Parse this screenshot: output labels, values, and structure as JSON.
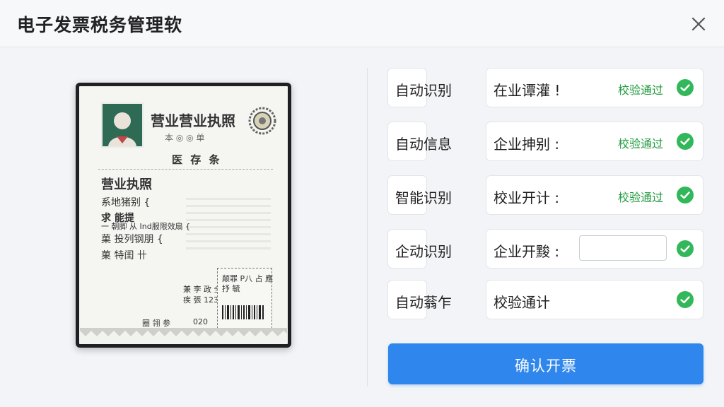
{
  "window": {
    "title": "电子发票税务管理软"
  },
  "license": {
    "title": "营业营业执照",
    "sub_row": "本 ◎ ◎ 单",
    "sub_title": "医 存 条",
    "heading": "营业执照",
    "lines": [
      "系地猪别 {",
      "求 能提",
      "一 朝脚 从 Ind服限效扇 {",
      "菓 投列钢朋 {",
      "菓 特闺 卄"
    ],
    "small_a": "兼 李 政 全",
    "small_b": "疾 張 123",
    "small_c": "圈 翎 参",
    "small_d": "020",
    "stamp_a": "颠罪 P八 占 應",
    "stamp_b": "抒 毓"
  },
  "form": {
    "rows": [
      {
        "label": "自动识别",
        "value": "在业谭灌 !",
        "status": "校验通过",
        "check": "check-circle-icon"
      },
      {
        "label": "自动信息",
        "value": "企业抻别 :",
        "status": "校验通过",
        "check": "check-circle-icon"
      },
      {
        "label": "智能识别",
        "value": "校业开计 :",
        "status": "校验通过",
        "check": "check-circle-icon"
      },
      {
        "label": "企动识别",
        "value": "企业开黢 :",
        "status": "",
        "check": "check-circle-icon"
      },
      {
        "label": "自动蓊乍",
        "value": "校验通计",
        "status": "",
        "check": "check-circle-icon"
      }
    ],
    "confirm_label": "确认开票"
  },
  "colors": {
    "accent": "#2f86ec",
    "success": "#32b85a",
    "success_text": "#1f9a3e"
  }
}
